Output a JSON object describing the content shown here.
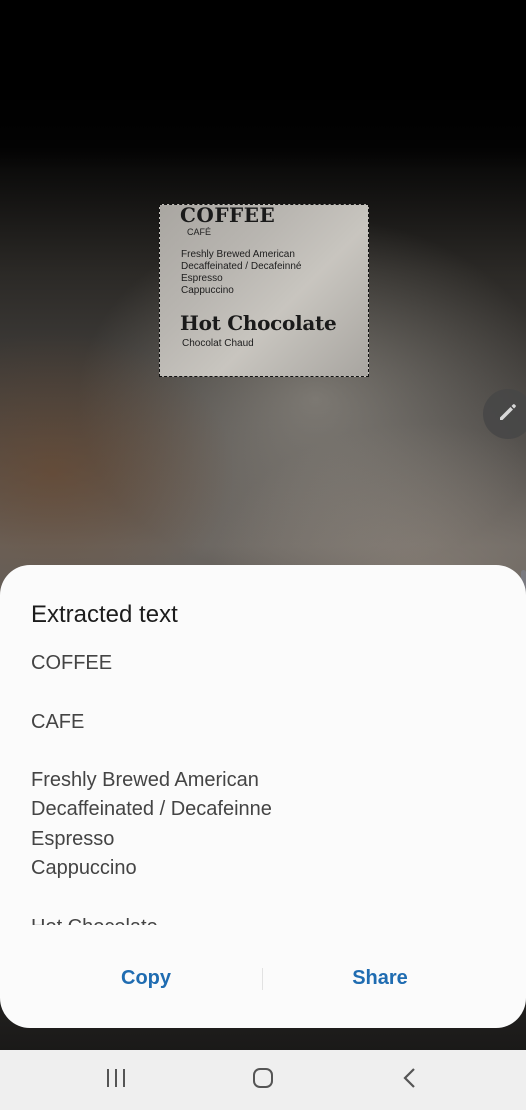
{
  "camera": {
    "selection_text": {
      "coffee": "COFFEE",
      "cafe": "CAFÉ",
      "menu_lines": [
        "Freshly Brewed American",
        "Decaffeinated / Decafeinné",
        "Espresso",
        "Cappuccino"
      ],
      "hot_chocolate": "Hot Chocolate",
      "chocolat_chaud": "Chocolat Chaud"
    }
  },
  "edit_button": {
    "icon": "pencil-icon"
  },
  "sheet": {
    "title": "Extracted text",
    "lines": [
      "COFFEE",
      "",
      "CAFE",
      "",
      "Freshly Brewed American",
      "Decaffeinated / Decafeinne",
      "Espresso",
      "Cappuccino",
      "",
      "Hot Chocolate"
    ],
    "copy_label": "Copy",
    "share_label": "Share"
  },
  "navbar": {
    "recent_icon": "recent-apps-icon",
    "home_icon": "home-icon",
    "back_icon": "back-icon"
  },
  "colors": {
    "accent": "#1f6cb1",
    "sheet_bg": "#fbfbfb",
    "navbar_bg": "#efefef"
  }
}
